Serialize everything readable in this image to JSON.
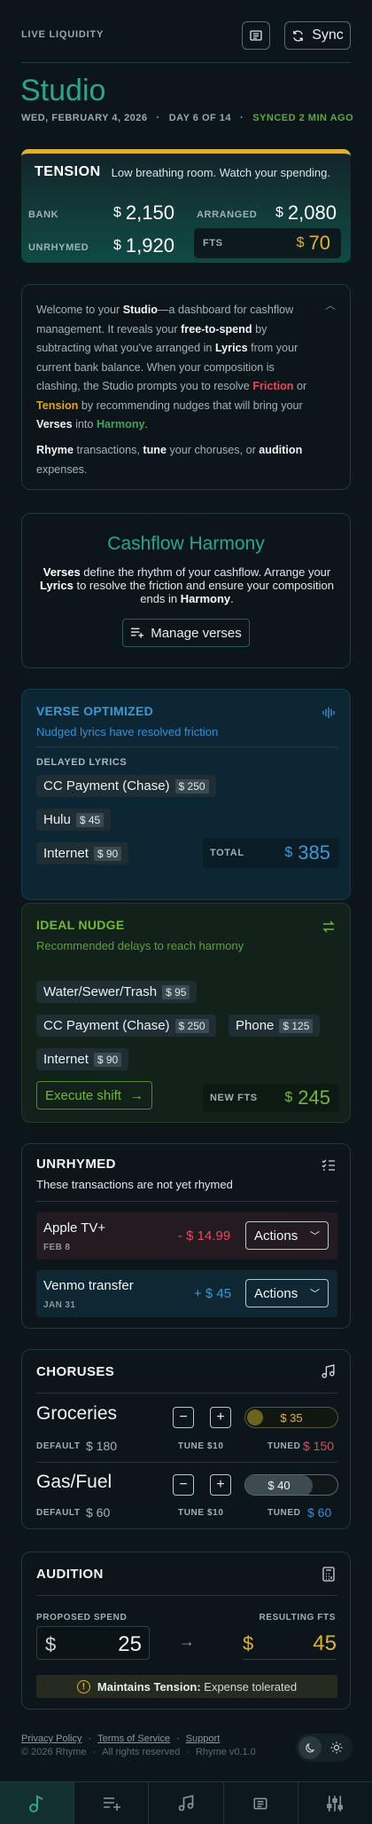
{
  "header": {
    "kicker": "LIVE LIQUIDITY",
    "sync_label": "Sync",
    "title": "Studio",
    "date": "WED, FEBRUARY 4, 2026",
    "day": "DAY 6 OF 14",
    "synced": "SYNCED 2 MIN AGO"
  },
  "tension": {
    "label": "TENSION",
    "note": "Low breathing room. Watch your spending.",
    "bank_label": "BANK",
    "bank": "2,150",
    "arranged_label": "ARRANGED",
    "arranged": "2,080",
    "unrhymed_label": "UNRHYMED",
    "unrhymed": "1,920",
    "fts_label": "FTS",
    "fts": "70",
    "currency": "$"
  },
  "intro": {
    "p1": [
      {
        "t": "Welcome to your "
      },
      {
        "t": "Studio",
        "b": 1
      },
      {
        "t": "—a dashboard for cashflow management. It reveals your "
      },
      {
        "t": "free-to-spend",
        "b": 1
      },
      {
        "t": " by subtracting what you've arranged in "
      },
      {
        "t": "Lyrics",
        "b": 1
      },
      {
        "t": " from your current bank balance. When your composition is clashing, the Studio prompts you to resolve "
      },
      {
        "t": "Friction",
        "c": "#e14b5a"
      },
      {
        "t": " or "
      },
      {
        "t": "Tension",
        "c": "#e0a325"
      },
      {
        "t": " by recommending nudges that will bring your "
      },
      {
        "t": "Verses",
        "b": 1
      },
      {
        "t": " into "
      },
      {
        "t": "Harmony",
        "c": "#3fa35a"
      },
      {
        "t": "."
      }
    ],
    "p2": [
      {
        "t": "Rhyme",
        "b": 1
      },
      {
        "t": " transactions, "
      },
      {
        "t": "tune",
        "b": 1
      },
      {
        "t": " your choruses, or "
      },
      {
        "t": "audition",
        "b": 1
      },
      {
        "t": " expenses."
      }
    ]
  },
  "harmony": {
    "title": "Cashflow Harmony",
    "desc": [
      {
        "t": "Verses",
        "b": 1
      },
      {
        "t": " define the rhythm of your cashflow. Arrange your "
      },
      {
        "t": "Lyrics",
        "b": 1
      },
      {
        "t": " to resolve the friction and ensure your composition ends in "
      },
      {
        "t": "Harmony",
        "b": 1
      },
      {
        "t": "."
      }
    ],
    "button": "Manage verses"
  },
  "verse": {
    "title": "VERSE OPTIMIZED",
    "subtitle": "Nudged lyrics have resolved friction",
    "delayed_label": "DELAYED LYRICS",
    "chips": [
      {
        "name": "CC Payment (Chase)",
        "amount": "$ 250"
      },
      {
        "name": "Hulu",
        "amount": "$ 45"
      },
      {
        "name": "Internet",
        "amount": "$ 90"
      }
    ],
    "total_label": "TOTAL",
    "total": "385"
  },
  "nudge": {
    "title": "IDEAL NUDGE",
    "subtitle": "Recommended delays to reach harmony",
    "chips": [
      {
        "name": "Water/Sewer/Trash",
        "amount": "$ 95"
      },
      {
        "name": "CC Payment (Chase)",
        "amount": "$ 250"
      },
      {
        "name": "Phone",
        "amount": "$ 125"
      },
      {
        "name": "Internet",
        "amount": "$ 90"
      }
    ],
    "execute": "Execute shift",
    "new_fts_label": "NEW FTS",
    "new_fts": "245"
  },
  "unrhymed": {
    "title": "UNRHYMED",
    "subtitle": "These transactions are not yet rhymed",
    "items": [
      {
        "name": "Apple TV+",
        "date": "FEB 8",
        "amount": "- $ 14.99",
        "action": "Actions"
      },
      {
        "name": "Venmo transfer",
        "date": "JAN 31",
        "amount": "+ $ 45",
        "action": "Actions"
      }
    ]
  },
  "choruses": {
    "title": "CHORUSES",
    "items": [
      {
        "name": "Groceries",
        "value": "$ 35",
        "default_label": "DEFAULT",
        "default": "$ 180",
        "tune": "TUNE $10",
        "tuned_label": "TUNED",
        "tuned": "$ 150",
        "tuned_color": "#e14b5a"
      },
      {
        "name": "Gas/Fuel",
        "value": "$ 40",
        "default_label": "DEFAULT",
        "default": "$ 60",
        "tune": "TUNE $10",
        "tuned_label": "TUNED",
        "tuned": "$ 60",
        "tuned_color": "#3b8ed1"
      }
    ]
  },
  "audition": {
    "title": "AUDITION",
    "proposed_label": "PROPOSED SPEND",
    "proposed": "25",
    "resulting_label": "RESULTING FTS",
    "resulting": "45",
    "note_bold": "Maintains Tension:",
    "note": " Expense tolerated"
  },
  "footer": {
    "links": [
      "Privacy Policy",
      "Terms of Service",
      "Support"
    ],
    "copyright": "© 2026 Rhyme",
    "rights": "All rights reserved",
    "version": "Rhyme v0.1.0"
  },
  "colors": {
    "accent": "#2aa68c",
    "tension": "#e0b233",
    "verse": "#3b8ed1",
    "nudge": "#74b63a",
    "friction": "#e14b5a"
  }
}
